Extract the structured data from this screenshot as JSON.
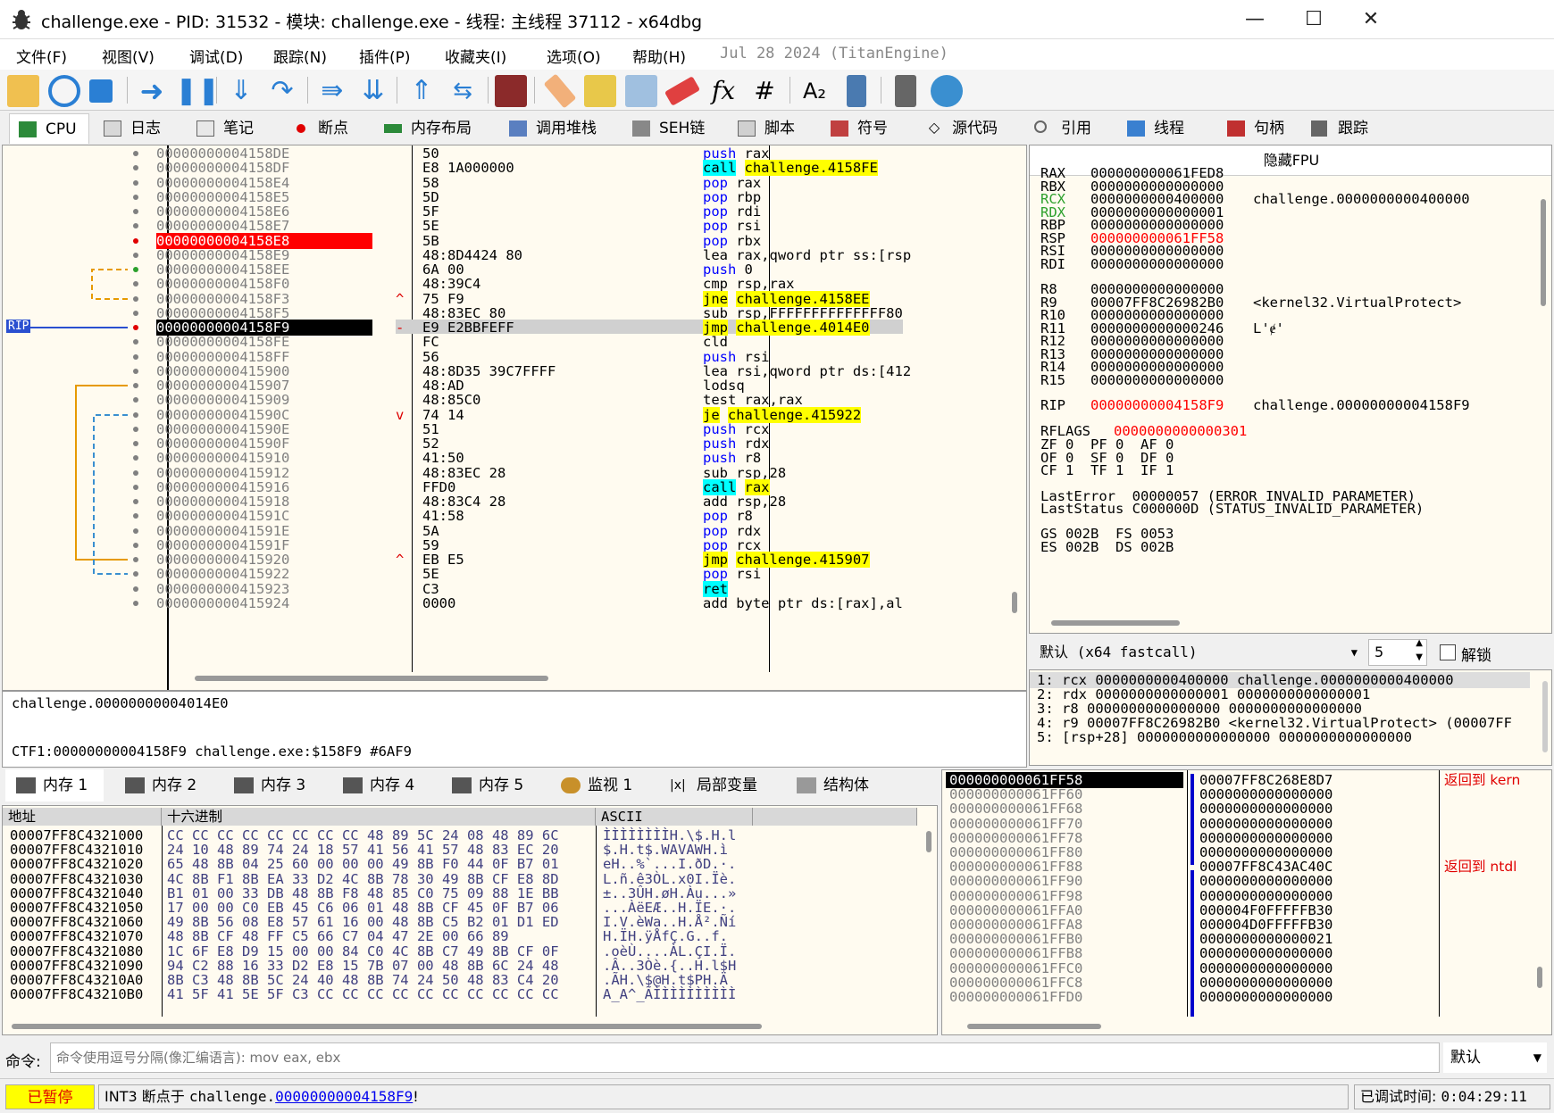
{
  "window": {
    "title": "challenge.exe - PID: 31532 - 模块: challenge.exe - 线程: 主线程 37112 - x64dbg"
  },
  "menu": [
    "文件(F)",
    "视图(V)",
    "调试(D)",
    "跟踪(N)",
    "插件(P)",
    "收藏夹(I)",
    "选项(O)",
    "帮助(H)",
    "Jul 28 2024 (TitanEngine)"
  ],
  "tabs": [
    "CPU",
    "日志",
    "笔记",
    "断点",
    "内存布局",
    "调用堆栈",
    "SEH链",
    "脚本",
    "符号",
    "源代码",
    "引用",
    "线程",
    "句柄",
    "跟踪"
  ],
  "disasm": {
    "addresses": [
      "00000000004158DE",
      "00000000004158DF",
      "00000000004158E4",
      "00000000004158E5",
      "00000000004158E6",
      "00000000004158E7",
      "00000000004158E8",
      "00000000004158E9",
      "00000000004158EE",
      "00000000004158F0",
      "00000000004158F3",
      "00000000004158F5",
      "00000000004158F9",
      "00000000004158FE",
      "00000000004158FF",
      "0000000000415900",
      "0000000000415907",
      "0000000000415909",
      "000000000041590C",
      "000000000041590E",
      "000000000041590F",
      "0000000000415910",
      "0000000000415912",
      "0000000000415916",
      "0000000000415918",
      "000000000041591C",
      "000000000041591E",
      "000000000041591F",
      "0000000000415920",
      "0000000000415922",
      "0000000000415923",
      "0000000000415924"
    ],
    "bytes": [
      "50",
      "E8 1A000000",
      "58",
      "5D",
      "5F",
      "5E",
      "5B",
      "48:8D4424 80",
      "6A 00",
      "48:39C4",
      "75 F9",
      "48:83EC 80",
      "E9 E2BBFEFF",
      "FC",
      "56",
      "48:8D35 39C7FFFF",
      "48:AD",
      "48:85C0",
      "74 14",
      "51",
      "52",
      "41:50",
      "48:83EC 28",
      "FFD0",
      "48:83C4 28",
      "41:58",
      "5A",
      "59",
      "EB E5",
      "5E",
      "C3",
      "0000"
    ],
    "mnem": [
      "push",
      "call",
      "pop",
      "pop",
      "pop",
      "pop",
      "pop",
      "lea",
      "push",
      "cmp",
      "jne",
      "sub",
      "jmp",
      "cld",
      "push",
      "lea",
      "lodsq",
      "test",
      "je",
      "push",
      "push",
      "push",
      "sub",
      "call",
      "add",
      "pop",
      "pop",
      "pop",
      "jmp",
      "pop",
      "ret",
      "add"
    ],
    "ops": [
      "rax",
      "challenge.4158FE",
      "rax",
      "rbp",
      "rdi",
      "rsi",
      "rbx",
      "rax,qword ptr ss:[rsp",
      "0",
      "rsp,rax",
      "challenge.4158EE",
      "rsp,FFFFFFFFFFFFFF80",
      "challenge.4014E0",
      "",
      "rsi",
      "rsi,qword ptr ds:[412",
      "",
      "rax,rax",
      "challenge.415922",
      "rcx",
      "rdx",
      "r8",
      "rsp,28",
      "rax",
      "rsp,28",
      "r8",
      "rdx",
      "rcx",
      "challenge.415907",
      "rsi",
      "",
      "byte ptr ds:[rax],al"
    ],
    "rip_label": "RIP"
  },
  "registers": {
    "header": "隐藏FPU",
    "gp": [
      [
        "RAX",
        "000000000061FED8",
        ""
      ],
      [
        "RBX",
        "0000000000000000",
        ""
      ],
      [
        "RCX",
        "0000000000400000",
        "challenge.0000000000400000"
      ],
      [
        "RDX",
        "0000000000000001",
        ""
      ],
      [
        "RBP",
        "0000000000000000",
        ""
      ],
      [
        "RSP",
        "000000000061FF58",
        ""
      ],
      [
        "RSI",
        "0000000000000000",
        ""
      ],
      [
        "RDI",
        "0000000000000000",
        ""
      ]
    ],
    "r": [
      [
        "R8",
        "0000000000000000",
        ""
      ],
      [
        "R9",
        "00007FF8C26982B0",
        "<kernel32.VirtualProtect>"
      ],
      [
        "R10",
        "0000000000000000",
        ""
      ],
      [
        "R11",
        "0000000000000246",
        "L'ɇ'"
      ],
      [
        "R12",
        "0000000000000000",
        ""
      ],
      [
        "R13",
        "0000000000000000",
        ""
      ],
      [
        "R14",
        "0000000000000000",
        ""
      ],
      [
        "R15",
        "0000000000000000",
        ""
      ]
    ],
    "rip": [
      "RIP",
      "00000000004158F9",
      "challenge.00000000004158F9"
    ],
    "rflags": [
      "RFLAGS",
      "0000000000000301"
    ],
    "flags": [
      "ZF 0  PF 0  AF 0",
      "OF 0  SF 0  DF 0",
      "CF 1  TF 1  IF 1"
    ],
    "lasterror": "LastError  00000057 (ERROR_INVALID_PARAMETER)",
    "laststatus": "LastStatus C000000D (STATUS_INVALID_PARAMETER)",
    "seg1": "GS 002B  FS 0053",
    "seg2": "ES 002B  DS 002B"
  },
  "callconv": {
    "value": "默认 (x64 fastcall)",
    "count": "5",
    "unlock": "解锁"
  },
  "args": [
    "1: rcx 0000000000400000 challenge.0000000000400000",
    "2: rdx 0000000000000001 0000000000000001",
    "3: r8 0000000000000000 0000000000000000",
    "4: r9 00007FF8C26982B0 <kernel32.VirtualProtect> (00007FF",
    "5: [rsp+28] 0000000000000000 0000000000000000"
  ],
  "info": {
    "line1": "challenge.00000000004014E0",
    "line2": "CTF1:00000000004158F9 challenge.exe:$158F9 #6AF9"
  },
  "dumptabs": [
    "内存 1",
    "内存 2",
    "内存 3",
    "内存 4",
    "内存 5",
    "监视 1",
    "局部变量",
    "结构体"
  ],
  "dump": {
    "headers": [
      "地址",
      "十六进制",
      "ASCII"
    ],
    "rows": [
      [
        "00007FF8C4321000",
        "CC CC CC CC CC CC CC CC 48 89 5C 24 08 48 89 6C",
        "ÌÌÌÌÌÌÌÌH.\\$.H.l"
      ],
      [
        "00007FF8C4321010",
        "24 10 48 89 74 24 18 57 41 56 41 57 48 83 EC 20",
        "$.H.t$.WAVAWH.ì "
      ],
      [
        "00007FF8C4321020",
        "65 48 8B 04 25 60 00 00 00 49 8B F0 44 0F B7 01",
        "eH..%`...I.ðD.·."
      ],
      [
        "00007FF8C4321030",
        "4C 8B F1 8B EA 33 D2 4C 8B 78 30 49 8B CF E8 8D",
        "L.ñ.ê3ÒL.x0I.Ïè."
      ],
      [
        "00007FF8C4321040",
        "B1 01 00 33 DB 48 8B F8 48 85 C0 75 09 88 1E BB",
        "±..3ÛH.øH.Àu...»"
      ],
      [
        "00007FF8C4321050",
        "17 00 00 C0 EB 45 C6 06 01 48 8B CF 45 0F B7 06",
        "...ÀëEÆ..H.ÏE.·."
      ],
      [
        "00007FF8C4321060",
        "49 8B 56 08 E8 57 61 16 00 48 8B C5 B2 01 D1 ED",
        "I.V.èWa..H.Å².Ñí"
      ],
      [
        "00007FF8C4321070",
        "48 8B CF 48 FF C5 66 C7 04 47 2E 00 66 89",
        "H.ÏH.ÿÅfÇ.G..f."
      ],
      [
        "00007FF8C4321080",
        "1C 6F E8 D9 15 00 00 84 C0 4C 8B C7 49 8B CF 0F",
        ".oèÙ....ÀL.ÇI.Ï."
      ],
      [
        "00007FF8C4321090",
        "94 C2 88 16 33 D2 E8 15 7B 07 00 48 8B 6C 24 48",
        ".Â..3Òè.{..H.l$H"
      ],
      [
        "00007FF8C43210A0",
        "8B C3 48 8B 5C 24 40 48 8B 74 24 50 48 83 C4 20",
        ".ÃH.\\$@H.t$PH.Ä "
      ],
      [
        "00007FF8C43210B0",
        "41 5F 41 5E 5F C3 CC CC CC CC CC CC CC CC CC CC",
        "A_A^_ÃÌÌÌÌÌÌÌÌÌÌ"
      ]
    ]
  },
  "stack": {
    "addrs": [
      "000000000061FF58",
      "000000000061FF60",
      "000000000061FF68",
      "000000000061FF70",
      "000000000061FF78",
      "000000000061FF80",
      "000000000061FF88",
      "000000000061FF90",
      "000000000061FF98",
      "000000000061FFA0",
      "000000000061FFA8",
      "000000000061FFB0",
      "000000000061FFB8",
      "000000000061FFC0",
      "000000000061FFC8",
      "000000000061FFD0"
    ],
    "vals": [
      "00007FF8C268E8D7",
      "0000000000000000",
      "0000000000000000",
      "0000000000000000",
      "0000000000000000",
      "0000000000000000",
      "00007FF8C43AC40C",
      "0000000000000000",
      "0000000000000000",
      "000004F0FFFFFB30",
      "000004D0FFFFFB30",
      "0000000000000021",
      "0000000000000000",
      "0000000000000000",
      "0000000000000000",
      "0000000000000000"
    ],
    "comments": [
      "返回到 kern",
      "",
      "",
      "",
      "",
      "",
      "返回到 ntdl",
      "",
      "",
      "",
      "",
      "",
      "",
      "",
      "",
      ""
    ]
  },
  "command": {
    "label": "命令:",
    "placeholder": "命令使用逗号分隔(像汇编语言): mov eax, ebx",
    "mode": "默认"
  },
  "status": {
    "state": "已暂停",
    "reason": "INT3 断点于",
    "module": "challenge.",
    "addr": "00000000004158F9",
    "bang": "!",
    "timelabel": "已调试时间:",
    "time": "0:04:29:11"
  }
}
